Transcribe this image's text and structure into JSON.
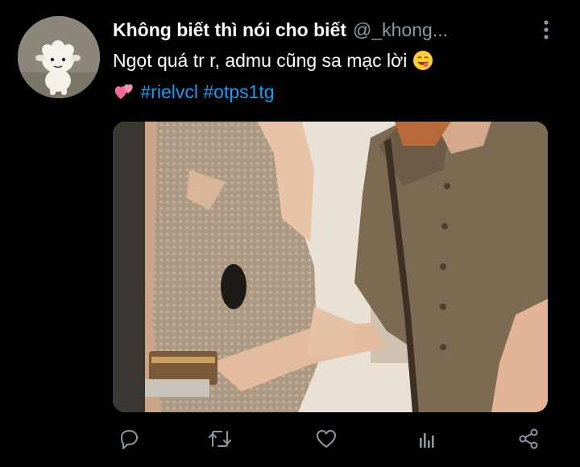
{
  "tweet": {
    "display_name": "Không biết thì nói cho biết",
    "handle": "@_khong...",
    "text_line1": "Ngọt quá tr r, admu cũng sa mạc lời",
    "text_line1_emoji": "face-savoring-food-emoji",
    "text_line2_emoji": "two-hearts-emoji",
    "hashtags": [
      "#rielvcl",
      "#otps1tg"
    ]
  },
  "actions": [
    {
      "name": "reply",
      "icon": "reply-icon"
    },
    {
      "name": "retweet",
      "icon": "retweet-icon"
    },
    {
      "name": "like",
      "icon": "like-icon"
    },
    {
      "name": "analytics",
      "icon": "analytics-icon"
    },
    {
      "name": "share",
      "icon": "share-icon"
    }
  ],
  "colors": {
    "background": "#000000",
    "text": "#ffffff",
    "muted": "#8b98a5",
    "link": "#1d9bf0"
  }
}
